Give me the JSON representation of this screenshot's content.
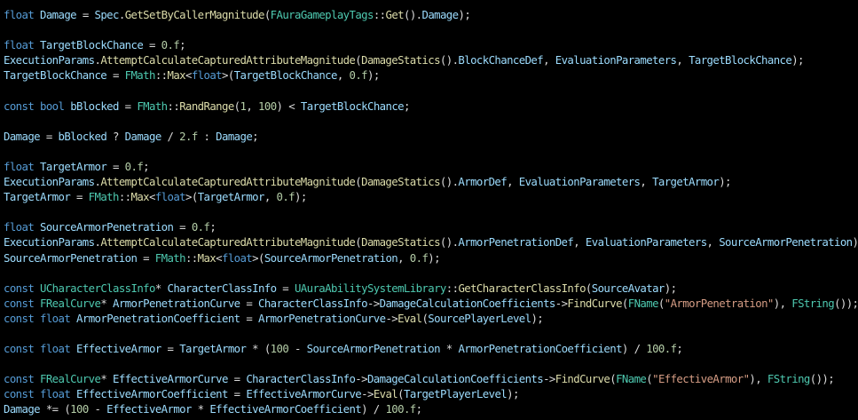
{
  "colors": {
    "background": "#000000",
    "keyword": "#569cd6",
    "variable": "#9cdcfe",
    "function": "#dcdcaa",
    "type": "#4ec9b0",
    "string": "#d69d85",
    "number": "#b5cea8",
    "macro": "#bd63c5",
    "plain": "#dadada"
  },
  "code_lines": [
    [
      [
        "kw",
        "float"
      ],
      [
        "plain",
        " "
      ],
      [
        "var",
        "Damage"
      ],
      [
        "plain",
        " = "
      ],
      [
        "var",
        "Spec"
      ],
      [
        "plain",
        "."
      ],
      [
        "fn",
        "GetSetByCallerMagnitude"
      ],
      [
        "plain",
        "("
      ],
      [
        "cls",
        "FAuraGameplayTags"
      ],
      [
        "plain",
        "::"
      ],
      [
        "fn",
        "Get"
      ],
      [
        "plain",
        "()."
      ],
      [
        "var",
        "Damage"
      ],
      [
        "plain",
        ");"
      ]
    ],
    [],
    [
      [
        "kw",
        "float"
      ],
      [
        "plain",
        " "
      ],
      [
        "var",
        "TargetBlockChance"
      ],
      [
        "plain",
        " = "
      ],
      [
        "num",
        "0.f"
      ],
      [
        "plain",
        ";"
      ]
    ],
    [
      [
        "var",
        "ExecutionParams"
      ],
      [
        "plain",
        "."
      ],
      [
        "fn",
        "AttemptCalculateCapturedAttributeMagnitude"
      ],
      [
        "plain",
        "("
      ],
      [
        "fn",
        "DamageStatics"
      ],
      [
        "plain",
        "()."
      ],
      [
        "var",
        "BlockChanceDef"
      ],
      [
        "plain",
        ", "
      ],
      [
        "var",
        "EvaluationParameters"
      ],
      [
        "plain",
        ", "
      ],
      [
        "var",
        "TargetBlockChance"
      ],
      [
        "plain",
        ");"
      ]
    ],
    [
      [
        "var",
        "TargetBlockChance"
      ],
      [
        "plain",
        " = "
      ],
      [
        "cls",
        "FMath"
      ],
      [
        "plain",
        "::"
      ],
      [
        "fn",
        "Max"
      ],
      [
        "plain",
        "<"
      ],
      [
        "kw",
        "float"
      ],
      [
        "plain",
        ">("
      ],
      [
        "var",
        "TargetBlockChance"
      ],
      [
        "plain",
        ", "
      ],
      [
        "num",
        "0.f"
      ],
      [
        "plain",
        ");"
      ]
    ],
    [],
    [
      [
        "kw",
        "const"
      ],
      [
        "plain",
        " "
      ],
      [
        "kw",
        "bool"
      ],
      [
        "plain",
        " "
      ],
      [
        "var",
        "bBlocked"
      ],
      [
        "plain",
        " = "
      ],
      [
        "cls",
        "FMath"
      ],
      [
        "plain",
        "::"
      ],
      [
        "fn",
        "RandRange"
      ],
      [
        "plain",
        "("
      ],
      [
        "num",
        "1"
      ],
      [
        "plain",
        ", "
      ],
      [
        "num",
        "100"
      ],
      [
        "plain",
        ") < "
      ],
      [
        "var",
        "TargetBlockChance"
      ],
      [
        "plain",
        ";"
      ]
    ],
    [],
    [
      [
        "var",
        "Damage"
      ],
      [
        "plain",
        " = "
      ],
      [
        "var",
        "bBlocked"
      ],
      [
        "plain",
        " ? "
      ],
      [
        "var",
        "Damage"
      ],
      [
        "plain",
        " / "
      ],
      [
        "num",
        "2.f"
      ],
      [
        "plain",
        " : "
      ],
      [
        "var",
        "Damage"
      ],
      [
        "plain",
        ";"
      ]
    ],
    [],
    [
      [
        "kw",
        "float"
      ],
      [
        "plain",
        " "
      ],
      [
        "var",
        "TargetArmor"
      ],
      [
        "plain",
        " = "
      ],
      [
        "num",
        "0.f"
      ],
      [
        "plain",
        ";"
      ]
    ],
    [
      [
        "var",
        "ExecutionParams"
      ],
      [
        "plain",
        "."
      ],
      [
        "fn",
        "AttemptCalculateCapturedAttributeMagnitude"
      ],
      [
        "plain",
        "("
      ],
      [
        "fn",
        "DamageStatics"
      ],
      [
        "plain",
        "()."
      ],
      [
        "var",
        "ArmorDef"
      ],
      [
        "plain",
        ", "
      ],
      [
        "var",
        "EvaluationParameters"
      ],
      [
        "plain",
        ", "
      ],
      [
        "var",
        "TargetArmor"
      ],
      [
        "plain",
        ");"
      ]
    ],
    [
      [
        "var",
        "TargetArmor"
      ],
      [
        "plain",
        " = "
      ],
      [
        "cls",
        "FMath"
      ],
      [
        "plain",
        "::"
      ],
      [
        "fn",
        "Max"
      ],
      [
        "plain",
        "<"
      ],
      [
        "kw",
        "float"
      ],
      [
        "plain",
        ">("
      ],
      [
        "var",
        "TargetArmor"
      ],
      [
        "plain",
        ", "
      ],
      [
        "num",
        "0.f"
      ],
      [
        "plain",
        ");"
      ]
    ],
    [],
    [
      [
        "kw",
        "float"
      ],
      [
        "plain",
        " "
      ],
      [
        "var",
        "SourceArmorPenetration"
      ],
      [
        "plain",
        " = "
      ],
      [
        "num",
        "0.f"
      ],
      [
        "plain",
        ";"
      ]
    ],
    [
      [
        "var",
        "ExecutionParams"
      ],
      [
        "plain",
        "."
      ],
      [
        "fn",
        "AttemptCalculateCapturedAttributeMagnitude"
      ],
      [
        "plain",
        "("
      ],
      [
        "fn",
        "DamageStatics"
      ],
      [
        "plain",
        "()."
      ],
      [
        "var",
        "ArmorPenetrationDef"
      ],
      [
        "plain",
        ", "
      ],
      [
        "var",
        "EvaluationParameters"
      ],
      [
        "plain",
        ", "
      ],
      [
        "var",
        "SourceArmorPenetration"
      ],
      [
        "plain",
        ");"
      ]
    ],
    [
      [
        "var",
        "SourceArmorPenetration"
      ],
      [
        "plain",
        " = "
      ],
      [
        "cls",
        "FMath"
      ],
      [
        "plain",
        "::"
      ],
      [
        "fn",
        "Max"
      ],
      [
        "plain",
        "<"
      ],
      [
        "kw",
        "float"
      ],
      [
        "plain",
        ">("
      ],
      [
        "var",
        "SourceArmorPenetration"
      ],
      [
        "plain",
        ", "
      ],
      [
        "num",
        "0.f"
      ],
      [
        "plain",
        ");"
      ]
    ],
    [],
    [
      [
        "kw",
        "const"
      ],
      [
        "plain",
        " "
      ],
      [
        "cls",
        "UCharacterClassInfo"
      ],
      [
        "plain",
        "* "
      ],
      [
        "var",
        "CharacterClassInfo"
      ],
      [
        "plain",
        " = "
      ],
      [
        "cls",
        "UAuraAbilitySystemLibrary"
      ],
      [
        "plain",
        "::"
      ],
      [
        "fn",
        "GetCharacterClassInfo"
      ],
      [
        "plain",
        "("
      ],
      [
        "var",
        "SourceAvatar"
      ],
      [
        "plain",
        ");"
      ]
    ],
    [
      [
        "kw",
        "const"
      ],
      [
        "plain",
        " "
      ],
      [
        "cls",
        "FRealCurve"
      ],
      [
        "plain",
        "* "
      ],
      [
        "var",
        "ArmorPenetrationCurve"
      ],
      [
        "plain",
        " = "
      ],
      [
        "var",
        "CharacterClassInfo"
      ],
      [
        "plain",
        "->"
      ],
      [
        "var",
        "DamageCalculationCoefficients"
      ],
      [
        "plain",
        "->"
      ],
      [
        "fn",
        "FindCurve"
      ],
      [
        "plain",
        "("
      ],
      [
        "cls",
        "FName"
      ],
      [
        "plain",
        "("
      ],
      [
        "str",
        "\"ArmorPenetration\""
      ],
      [
        "plain",
        "), "
      ],
      [
        "cls",
        "FString"
      ],
      [
        "plain",
        "());"
      ]
    ],
    [
      [
        "kw",
        "const"
      ],
      [
        "plain",
        " "
      ],
      [
        "kw",
        "float"
      ],
      [
        "plain",
        " "
      ],
      [
        "var",
        "ArmorPenetrationCoefficient"
      ],
      [
        "plain",
        " = "
      ],
      [
        "var",
        "ArmorPenetrationCurve"
      ],
      [
        "plain",
        "->"
      ],
      [
        "fn",
        "Eval"
      ],
      [
        "plain",
        "("
      ],
      [
        "var",
        "SourcePlayerLevel"
      ],
      [
        "plain",
        ");"
      ]
    ],
    [],
    [
      [
        "kw",
        "const"
      ],
      [
        "plain",
        " "
      ],
      [
        "kw",
        "float"
      ],
      [
        "plain",
        " "
      ],
      [
        "var",
        "EffectiveArmor"
      ],
      [
        "plain",
        " = "
      ],
      [
        "var",
        "TargetArmor"
      ],
      [
        "plain",
        " * ("
      ],
      [
        "num",
        "100"
      ],
      [
        "plain",
        " - "
      ],
      [
        "var",
        "SourceArmorPenetration"
      ],
      [
        "plain",
        " * "
      ],
      [
        "var",
        "ArmorPenetrationCoefficient"
      ],
      [
        "plain",
        ") / "
      ],
      [
        "num",
        "100.f"
      ],
      [
        "plain",
        ";"
      ]
    ],
    [],
    [
      [
        "kw",
        "const"
      ],
      [
        "plain",
        " "
      ],
      [
        "cls",
        "FRealCurve"
      ],
      [
        "plain",
        "* "
      ],
      [
        "var",
        "EffectiveArmorCurve"
      ],
      [
        "plain",
        " = "
      ],
      [
        "var",
        "CharacterClassInfo"
      ],
      [
        "plain",
        "->"
      ],
      [
        "var",
        "DamageCalculationCoefficients"
      ],
      [
        "plain",
        "->"
      ],
      [
        "fn",
        "FindCurve"
      ],
      [
        "plain",
        "("
      ],
      [
        "cls",
        "FName"
      ],
      [
        "plain",
        "("
      ],
      [
        "str",
        "\"EffectiveArmor\""
      ],
      [
        "plain",
        "), "
      ],
      [
        "cls",
        "FString"
      ],
      [
        "plain",
        "());"
      ]
    ],
    [
      [
        "kw",
        "const"
      ],
      [
        "plain",
        " "
      ],
      [
        "kw",
        "float"
      ],
      [
        "plain",
        " "
      ],
      [
        "var",
        "EffectiveArmorCoefficient"
      ],
      [
        "plain",
        " = "
      ],
      [
        "var",
        "EffectiveArmorCurve"
      ],
      [
        "plain",
        "->"
      ],
      [
        "fn",
        "Eval"
      ],
      [
        "plain",
        "("
      ],
      [
        "var",
        "TargetPlayerLevel"
      ],
      [
        "plain",
        ");"
      ]
    ],
    [
      [
        "var",
        "Damage"
      ],
      [
        "plain",
        " *= ("
      ],
      [
        "num",
        "100"
      ],
      [
        "plain",
        " - "
      ],
      [
        "var",
        "EffectiveArmor"
      ],
      [
        "plain",
        " * "
      ],
      [
        "var",
        "EffectiveArmorCoefficient"
      ],
      [
        "plain",
        ") / "
      ],
      [
        "num",
        "100.f"
      ],
      [
        "plain",
        ";"
      ]
    ]
  ]
}
